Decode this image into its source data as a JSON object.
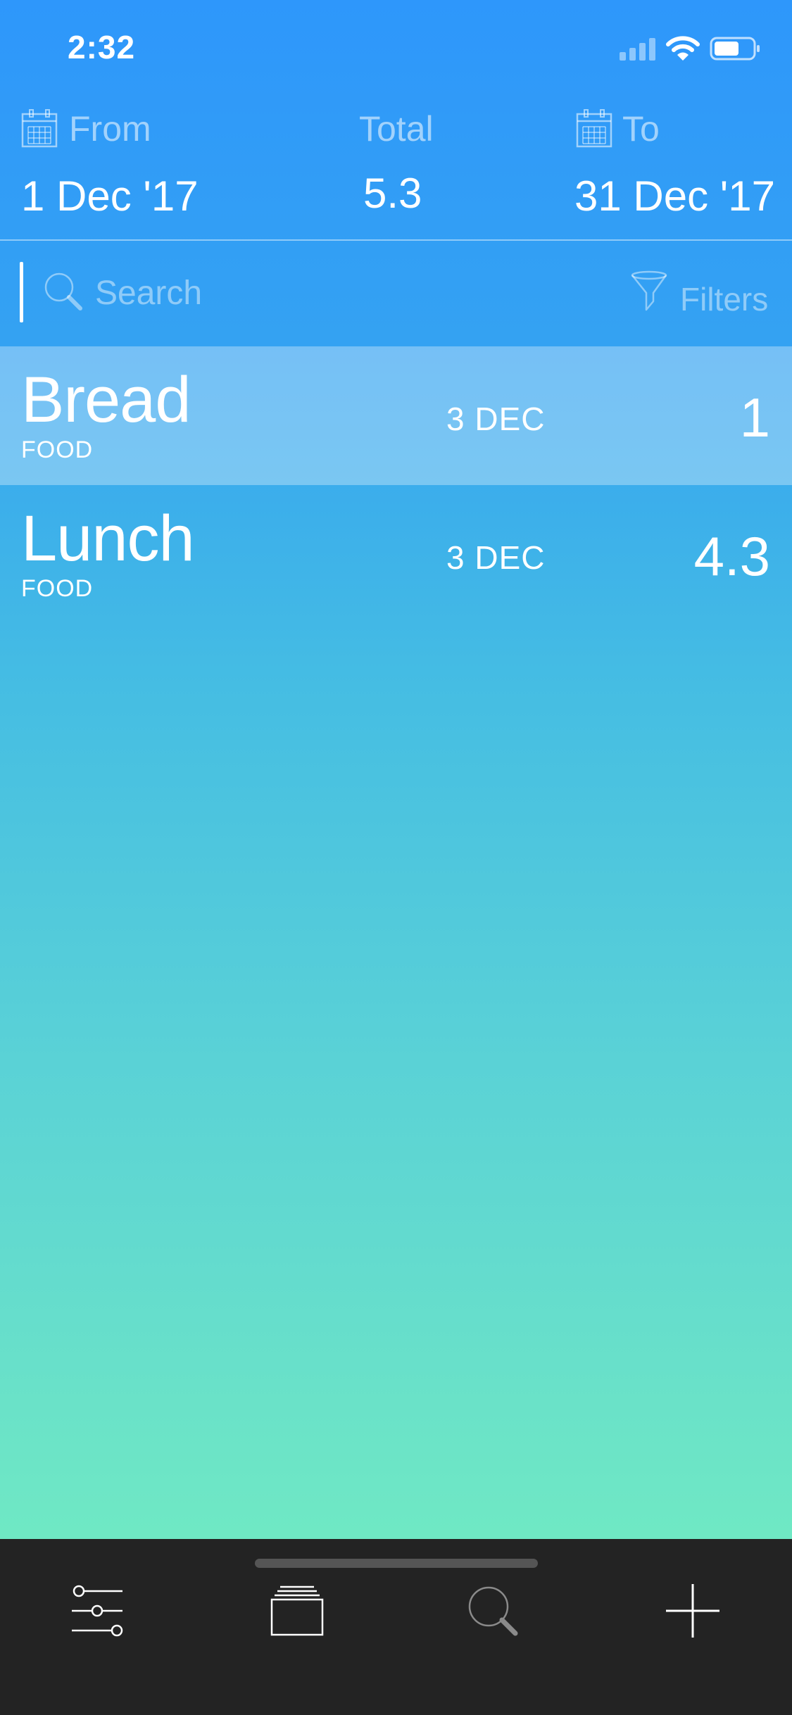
{
  "status_bar": {
    "time": "2:32",
    "signal_icon": "cellular-signal-icon",
    "wifi_icon": "wifi-icon",
    "battery_icon": "battery-icon"
  },
  "header": {
    "from_label": "From",
    "from_value": "1 Dec '17",
    "total_label": "Total",
    "total_value": "5.3",
    "to_label": "To",
    "to_value": "31 Dec '17",
    "calendar_icon": "calendar-icon"
  },
  "search": {
    "placeholder": "Search",
    "value": "",
    "icon": "search-icon",
    "filters_label": "Filters",
    "filters_icon": "funnel-icon"
  },
  "entries": [
    {
      "title": "Bread",
      "category": "FOOD",
      "date": "3 DEC",
      "amount": "1",
      "selected": true
    },
    {
      "title": "Lunch",
      "category": "FOOD",
      "date": "3 DEC",
      "amount": "4.3",
      "selected": false
    }
  ],
  "tab_bar": {
    "tabs": [
      {
        "icon": "sliders-icon"
      },
      {
        "icon": "stack-icon"
      },
      {
        "icon": "search-icon"
      },
      {
        "icon": "plus-icon"
      }
    ]
  },
  "colors": {
    "gradient_top": "#2e97fb",
    "gradient_bottom": "#76f1bf",
    "tab_bar_bg": "#232323"
  }
}
